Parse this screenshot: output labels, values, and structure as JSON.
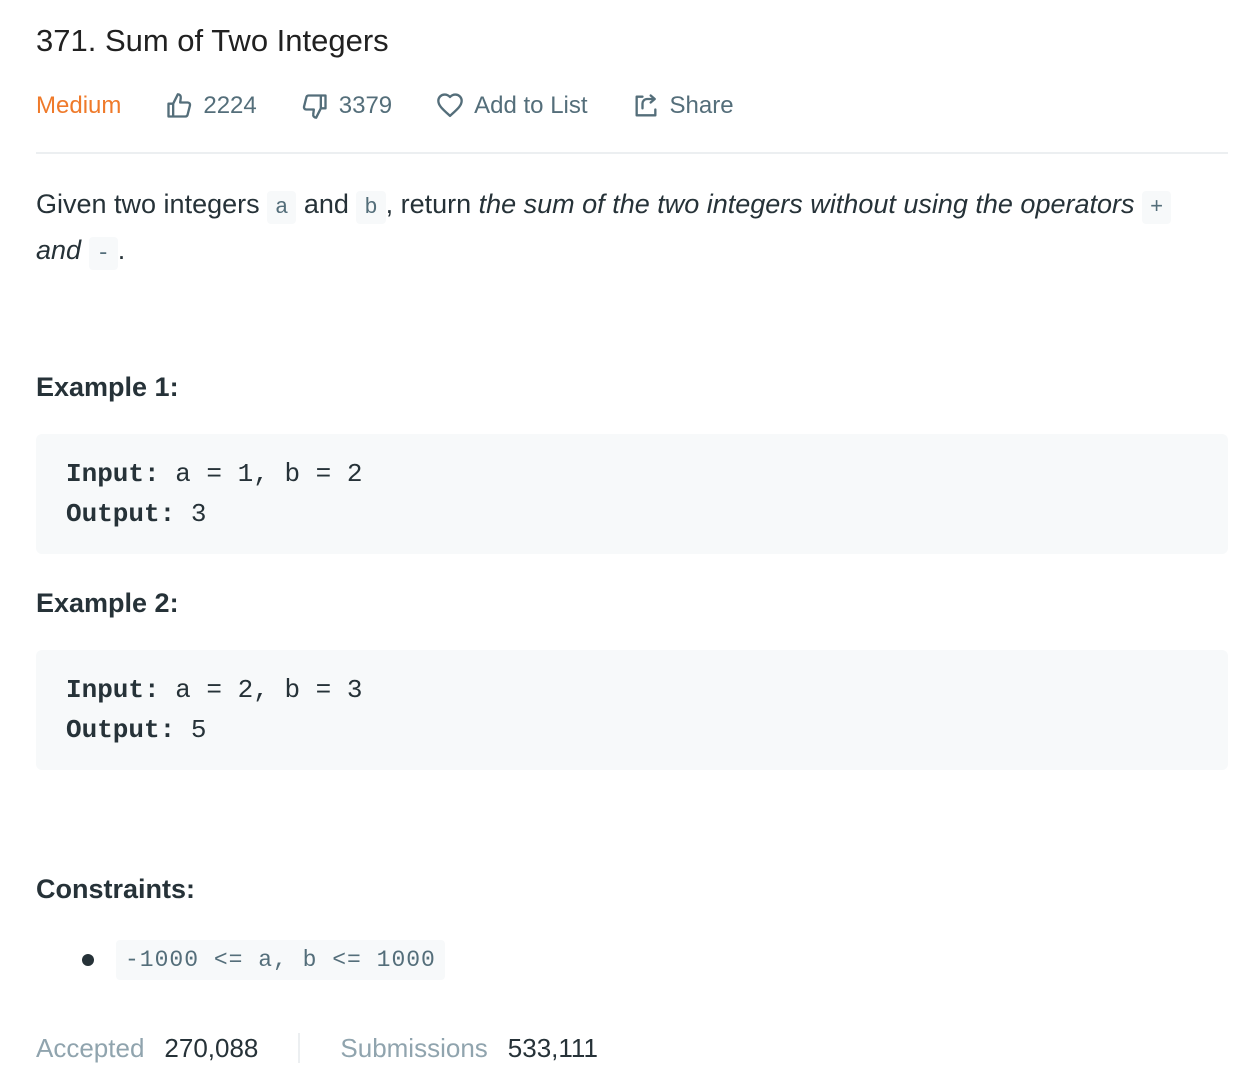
{
  "problem": {
    "title": "371. Sum of Two Integers",
    "difficulty": "Medium",
    "likes": "2224",
    "dislikes": "3379",
    "add_to_list_label": "Add to List",
    "share_label": "Share"
  },
  "description": {
    "text_1": "Given two integers ",
    "code_a": "a",
    "text_2": " and ",
    "code_b": "b",
    "text_3": ", return ",
    "italic_1": "the sum of the two integers without using the operators ",
    "code_plus": "+",
    "italic_2": " and ",
    "code_minus": "-",
    "text_4": "."
  },
  "examples": [
    {
      "heading": "Example 1:",
      "input_label": "Input:",
      "input_value": " a = 1, b = 2",
      "output_label": "Output:",
      "output_value": " 3"
    },
    {
      "heading": "Example 2:",
      "input_label": "Input:",
      "input_value": " a = 2, b = 3",
      "output_label": "Output:",
      "output_value": " 5"
    }
  ],
  "constraints": {
    "heading": "Constraints:",
    "items": [
      "-1000 <= a, b <= 1000"
    ]
  },
  "stats": {
    "accepted_label": "Accepted",
    "accepted_value": "270,088",
    "submissions_label": "Submissions",
    "submissions_value": "533,111"
  },
  "colors": {
    "difficulty_medium": "#ef7a2a",
    "code_background": "#f7f9fa",
    "muted_text": "#90a4ae"
  },
  "icons": {
    "like": "thumbs-up-icon",
    "dislike": "thumbs-down-icon",
    "add_to_list": "heart-icon",
    "share": "share-icon"
  }
}
